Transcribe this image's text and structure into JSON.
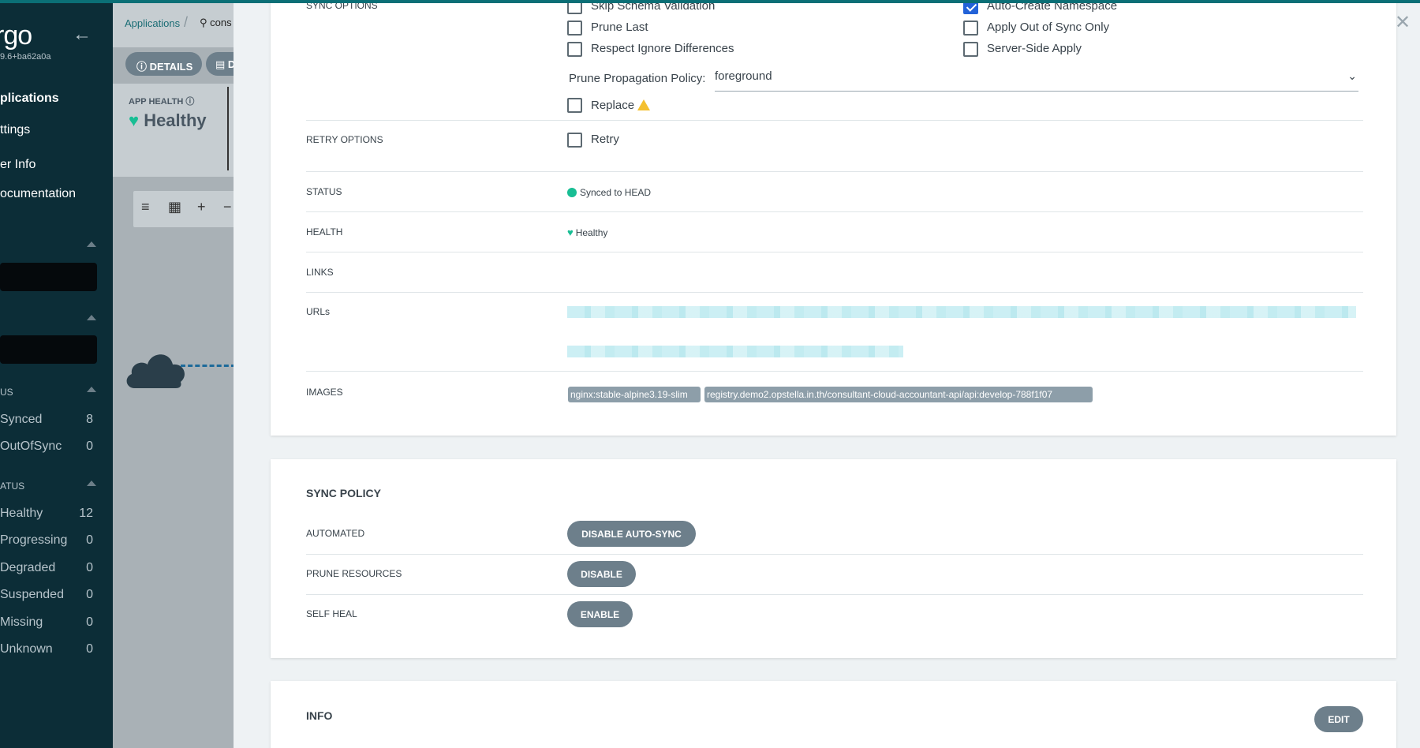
{
  "nav": {
    "logo": "rgo",
    "version": "9.6+ba62a0a",
    "back_icon": "arrow-left-icon",
    "items": [
      "plications",
      "ttings",
      "er Info",
      "ocumentation"
    ],
    "sync_status_title": "US",
    "sync_filters": [
      {
        "label": "Synced",
        "count": "8"
      },
      {
        "label": "OutOfSync",
        "count": "0"
      }
    ],
    "health_status_title": "ATUS",
    "health_filters": [
      {
        "label": "Healthy",
        "count": "12"
      },
      {
        "label": "Progressing",
        "count": "0"
      },
      {
        "label": "Degraded",
        "count": "0"
      },
      {
        "label": "Suspended",
        "count": "0"
      },
      {
        "label": "Missing",
        "count": "0"
      },
      {
        "label": "Unknown",
        "count": "0"
      }
    ]
  },
  "background": {
    "breadcrumb_app": "Applications",
    "breadcrumb_search": "cons",
    "details_button": "DETAILS",
    "second_button": "D",
    "app_health_label": "APP HEALTH",
    "app_health_value": "Healthy"
  },
  "panel": {
    "close_icon": "close-icon",
    "sync_options": {
      "label": "SYNC OPTIONS",
      "left": [
        {
          "label": "Skip Schema Validation",
          "checked": false
        },
        {
          "label": "Prune Last",
          "checked": false
        },
        {
          "label": "Respect Ignore Differences",
          "checked": false
        }
      ],
      "right": [
        {
          "label": "Auto-Create Namespace",
          "checked": true
        },
        {
          "label": "Apply Out of Sync Only",
          "checked": false
        },
        {
          "label": "Server-Side Apply",
          "checked": false
        }
      ],
      "prune_propagation_label": "Prune Propagation Policy:",
      "prune_propagation_value": "foreground",
      "replace_label": "Replace"
    },
    "retry_options": {
      "label": "RETRY OPTIONS",
      "retry_label": "Retry"
    },
    "status": {
      "label": "STATUS",
      "value": "Synced to HEAD"
    },
    "health": {
      "label": "HEALTH",
      "value": "Healthy"
    },
    "links": {
      "label": "LINKS"
    },
    "urls": {
      "label": "URLs"
    },
    "images": {
      "label": "IMAGES",
      "tags": [
        "nginx:stable-alpine3.19-slim",
        "registry.demo2.opstella.in.th/consultant-cloud-accountant-api/api:develop-788f1f07"
      ]
    },
    "sync_policy": {
      "title": "SYNC POLICY",
      "rows": [
        {
          "label": "AUTOMATED",
          "button": "DISABLE AUTO-SYNC"
        },
        {
          "label": "PRUNE RESOURCES",
          "button": "DISABLE"
        },
        {
          "label": "SELF HEAL",
          "button": "ENABLE"
        }
      ]
    },
    "info": {
      "title": "INFO",
      "edit_button": "EDIT"
    }
  }
}
